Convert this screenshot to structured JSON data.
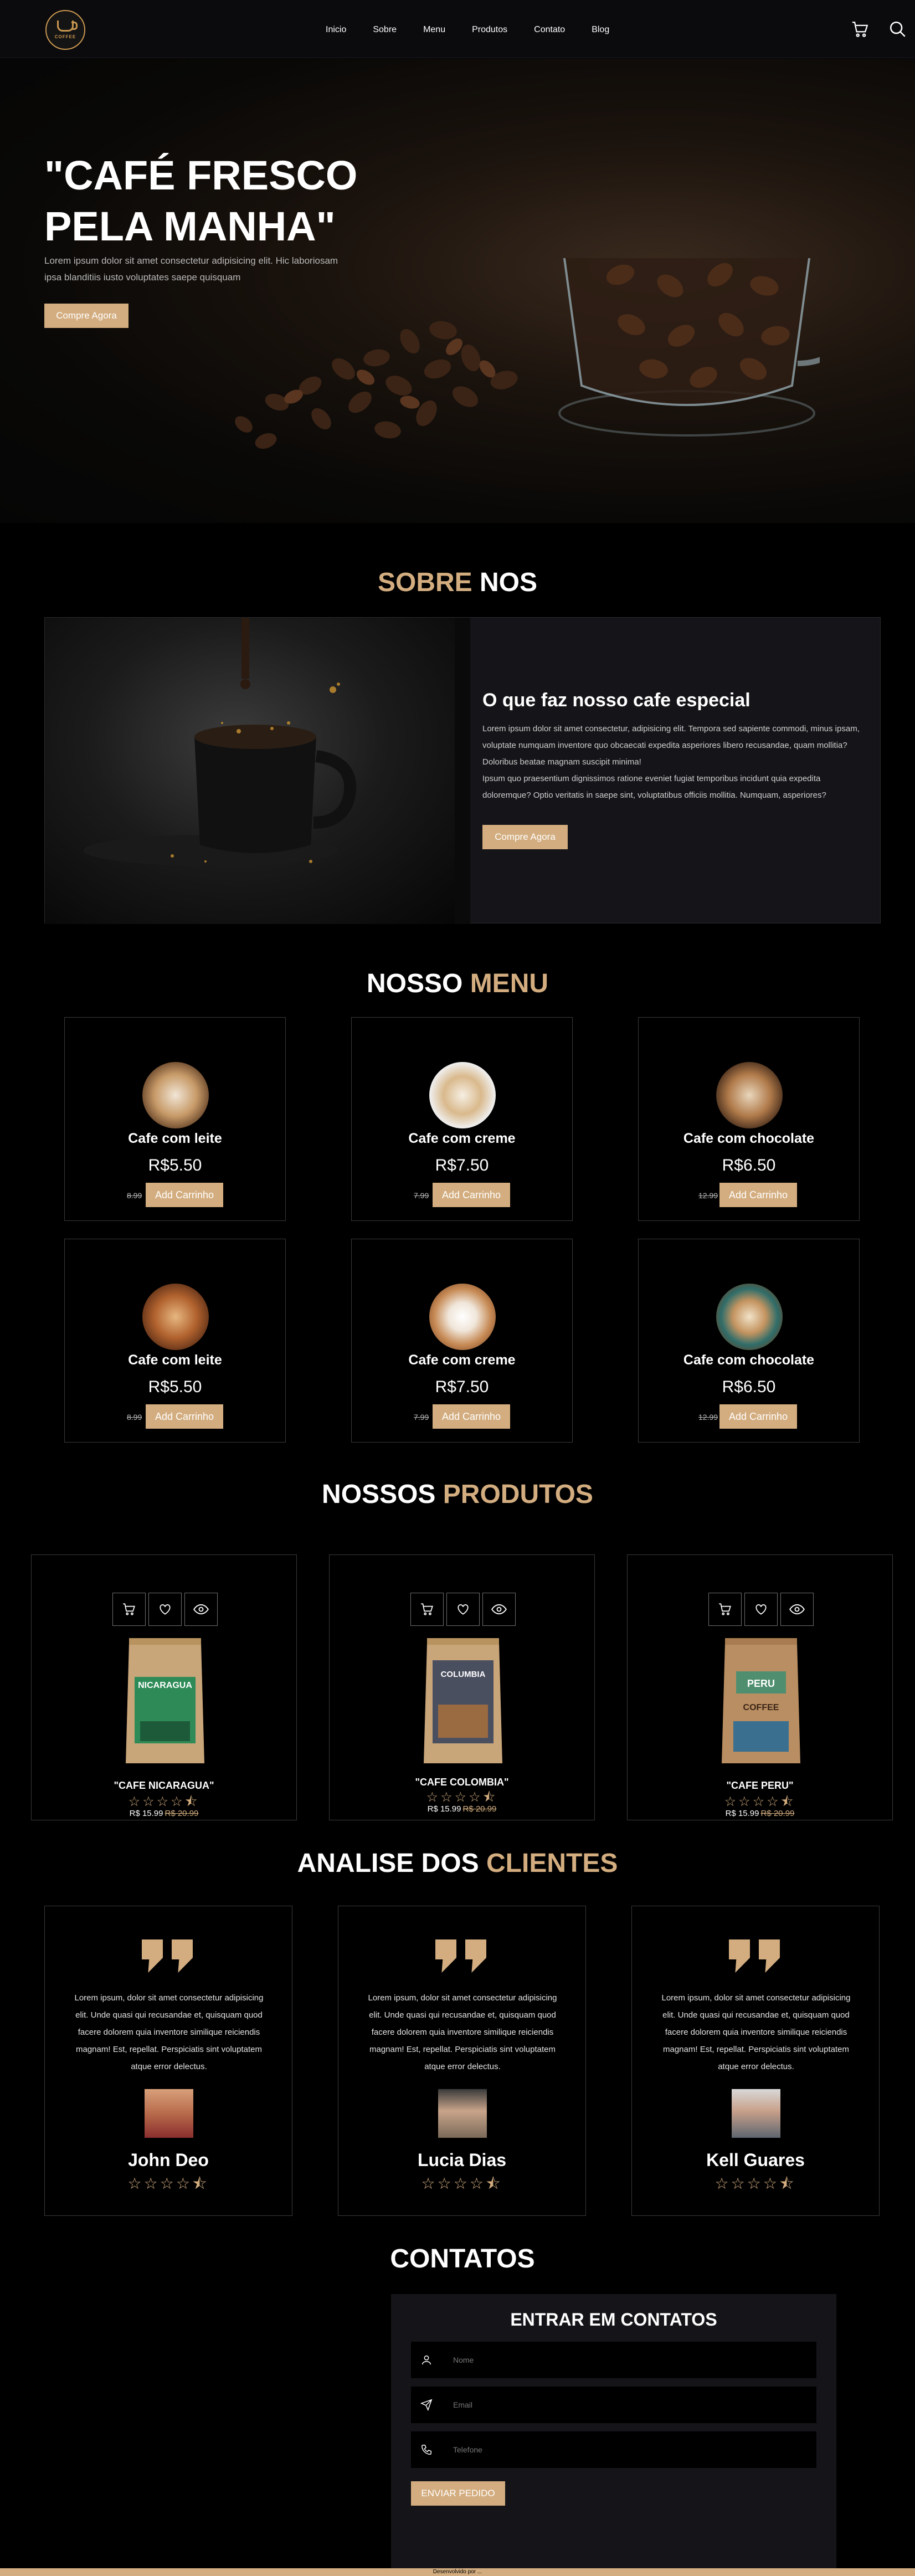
{
  "header": {
    "logo_text": "COFFEE",
    "nav": [
      "Inicio",
      "Sobre",
      "Menu",
      "Produtos",
      "Contato",
      "Blog"
    ],
    "icons": [
      "cart-icon",
      "search-icon"
    ]
  },
  "hero": {
    "title": "\"CAFÉ FRESCO PELA MANHA\"",
    "text": "Lorem ipsum dolor sit amet consectetur adipisicing elit. Hic laboriosam ipsa blanditiis iusto voluptates saepe quisquam",
    "button": "Compre Agora"
  },
  "about": {
    "title_a": "SOBRE",
    "title_b": "NOS",
    "heading": "O que faz nosso cafe especial",
    "p1": "Lorem ipsum dolor sit amet consectetur, adipisicing elit. Tempora sed sapiente commodi, minus ipsam, voluptate numquam inventore quo obcaecati expedita asperiores libero recusandae, quam mollitia? Doloribus beatae magnam suscipit minima!",
    "p2": "Ipsum quo praesentium dignissimos ratione eveniet fugiat temporibus incidunt quia expedita doloremque? Optio veritatis in saepe sint, voluptatibus officiis mollitia. Numquam, asperiores?",
    "button": "Compre Agora"
  },
  "menu": {
    "title_a": "NOSSO",
    "title_b": "MENU",
    "items": [
      {
        "name": "Cafe com leite",
        "price": "R$5.50",
        "old": "8.99",
        "button": "Add Carrinho"
      },
      {
        "name": "Cafe com creme",
        "price": "R$7.50",
        "old": "7.99",
        "button": "Add Carrinho"
      },
      {
        "name": "Cafe com chocolate",
        "price": "R$6.50",
        "old": "12.99",
        "button": "Add Carrinho"
      },
      {
        "name": "Cafe com leite",
        "price": "R$5.50",
        "old": "8.99",
        "button": "Add Carrinho"
      },
      {
        "name": "Cafe com creme",
        "price": "R$7.50",
        "old": "7.99",
        "button": "Add Carrinho"
      },
      {
        "name": "Cafe com chocolate",
        "price": "R$6.50",
        "old": "12.99",
        "button": "Add Carrinho"
      }
    ]
  },
  "products": {
    "title_a": "NOSSOS",
    "title_b": "PRODUTOS",
    "items": [
      {
        "name": "\"CAFE NICARAGUA\"",
        "price": "R$ 15.99",
        "old": "R$ 20.99",
        "bag_label": "NICARAGUA",
        "bag_color": "#2e8b57"
      },
      {
        "name": "\"CAFE COLOMBIA\"",
        "price": "R$ 15.99",
        "old": "R$ 20.99",
        "bag_label": "COLUMBIA",
        "bag_color": "#4a4f60"
      },
      {
        "name": "\"CAFE PERU\"",
        "price": "R$ 15.99",
        "old": "R$ 20.99",
        "bag_label": "PERU",
        "bag_color": "#7a5a3c"
      }
    ],
    "stars": "☆☆☆☆⯪"
  },
  "reviews": {
    "title_a": "ANALISE DOS",
    "title_b": "CLIENTES",
    "text": "Lorem ipsum, dolor sit amet consectetur adipisicing elit. Unde quasi qui recusandae et, quisquam quod facere dolorem quia inventore similique reiciendis magnam! Est, repellat. Perspiciatis sint voluptatem atque error delectus.",
    "items": [
      {
        "name": "John Deo",
        "avatar_color": "#b86b4b"
      },
      {
        "name": "Lucia Dias",
        "avatar_color": "#7b6a5a"
      },
      {
        "name": "Kell Guares",
        "avatar_color": "#5e6670"
      }
    ],
    "stars": "☆☆☆☆⯪"
  },
  "contact": {
    "title": "CONTATOS",
    "form_title": "ENTRAR EM CONTATOS",
    "fields": [
      {
        "placeholder": "Nome",
        "icon": "user-icon"
      },
      {
        "placeholder": "Email",
        "icon": "send-icon"
      },
      {
        "placeholder": "Telefone",
        "icon": "phone-icon"
      }
    ],
    "button": "ENVIAR PEDIDO"
  },
  "footer": {
    "text": "Desenvolvido por ..."
  },
  "colors": {
    "accent": "#d3ad7f",
    "bg": "#000000",
    "panel": "#151519"
  }
}
